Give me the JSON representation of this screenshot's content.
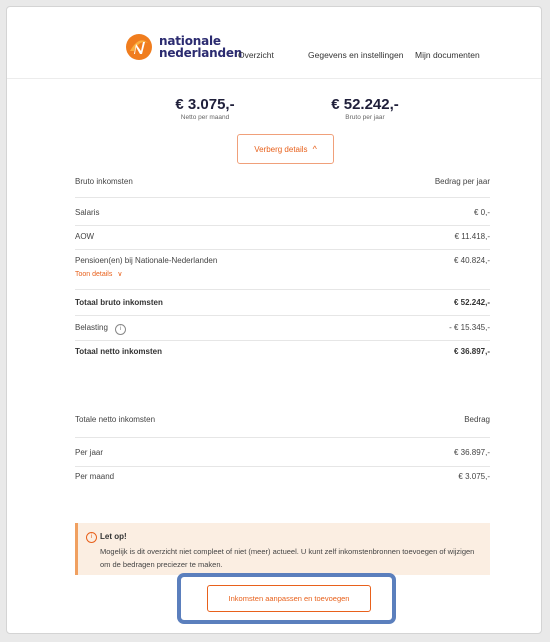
{
  "header": {
    "logo_line1": "nationale",
    "logo_line2": "nederlanden",
    "nav": [
      "Overzicht",
      "Gegevens en instellingen",
      "Mijn documenten"
    ]
  },
  "summary": {
    "netto_amount": "€ 3.075,-",
    "netto_label": "Netto per maand",
    "bruto_amount": "€ 52.242,-",
    "bruto_label": "Bruto per jaar"
  },
  "toggle_label": "Verberg details",
  "income_table": {
    "header_left": "Bruto inkomsten",
    "header_right": "Bedrag per jaar",
    "rows": [
      {
        "label": "Salaris",
        "value": "€ 0,-"
      },
      {
        "label": "AOW",
        "value": "€ 11.418,-"
      },
      {
        "label": "Pensioen(en) bij Nationale-Nederlanden",
        "value": "€ 40.824,-"
      }
    ],
    "details_link": "Toon details",
    "total_bruto_label": "Totaal bruto inkomsten",
    "total_bruto_value": "€ 52.242,-",
    "tax_label": "Belasting",
    "tax_value": "- € 15.345,-",
    "total_netto_label": "Totaal netto inkomsten",
    "total_netto_value": "€ 36.897,-"
  },
  "netto_table": {
    "header_left": "Totale netto inkomsten",
    "header_right": "Bedrag",
    "rows": [
      {
        "label": "Per jaar",
        "value": "€ 36.897,-"
      },
      {
        "label": "Per maand",
        "value": "€ 3.075,-"
      }
    ]
  },
  "alert": {
    "title": "Let op!",
    "text": "Mogelijk is dit overzicht niet compleet of niet (meer) actueel. U kunt zelf inkomstenbronnen toevoegen of wijzigen om de bedragen preciezer te maken."
  },
  "action_button": "Inkomsten aanpassen en toevoegen",
  "colors": {
    "accent": "#e8611c",
    "brand_navy": "#2b2b70",
    "highlight": "#5b7fbd",
    "alert_bg": "#fbeee2"
  }
}
